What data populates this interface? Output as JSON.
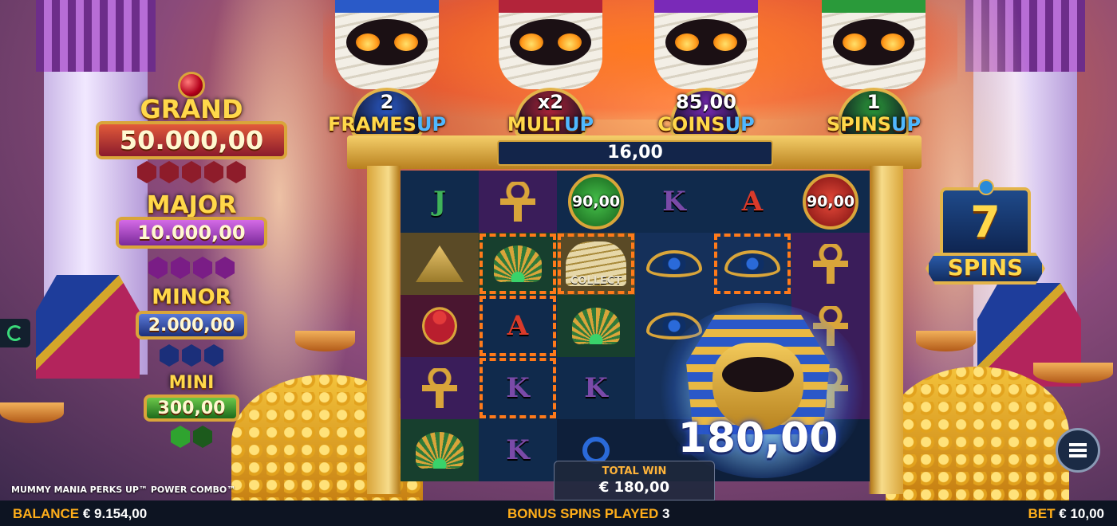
{
  "game": {
    "name": "MUMMY MANIA PERKS UP™ POWER COMBO™"
  },
  "jackpots": {
    "grand": {
      "label": "GRAND",
      "value": "50.000,00"
    },
    "major": {
      "label": "MAJOR",
      "value": "10.000,00"
    },
    "minor": {
      "label": "MINOR",
      "value": "2.000,00"
    },
    "mini": {
      "label": "MINI",
      "value": "300,00"
    }
  },
  "perks": [
    {
      "value": "2",
      "label": "FRAMES",
      "up": "UP",
      "color": "#2a5ac8"
    },
    {
      "value": "x2",
      "label": "MULT",
      "up": "UP",
      "color": "#b3243a"
    },
    {
      "value": "85,00",
      "label": "COINS",
      "up": "UP",
      "color": "#7a2ab8"
    },
    {
      "value": "1",
      "label": "SPINS",
      "up": "UP",
      "color": "#2a9a3a"
    }
  ],
  "collected_value": "16,00",
  "grid": {
    "rows": [
      [
        {
          "symbol": "letter",
          "text": "J",
          "variant": "j",
          "bg": "navy"
        },
        {
          "symbol": "ankh",
          "text": "",
          "bg": "purple"
        },
        {
          "symbol": "coin",
          "text": "90,00",
          "variant": "green",
          "bg": "navy"
        },
        {
          "symbol": "letter",
          "text": "K",
          "variant": "k",
          "bg": "navy"
        },
        {
          "symbol": "letter",
          "text": "A",
          "variant": "a",
          "bg": "navy"
        },
        {
          "symbol": "coin",
          "text": "90,00",
          "variant": "red",
          "bg": "navy"
        }
      ],
      [
        {
          "symbol": "pyramid",
          "text": "",
          "bg": "gold"
        },
        {
          "symbol": "fan",
          "text": "",
          "bg": "green",
          "highlight": true
        },
        {
          "symbol": "collect",
          "text": "COLLECT",
          "bg": "gold",
          "highlight": true
        },
        {
          "symbol": "eye",
          "text": "",
          "bg": "blue"
        },
        {
          "symbol": "eye",
          "text": "",
          "bg": "blue",
          "highlight": true
        },
        {
          "symbol": "ankh",
          "text": "",
          "bg": "purple"
        }
      ],
      [
        {
          "symbol": "scarab",
          "text": "",
          "bg": "red"
        },
        {
          "symbol": "letter",
          "text": "A",
          "variant": "a",
          "bg": "navy",
          "highlight": true
        },
        {
          "symbol": "fan",
          "text": "",
          "bg": "green"
        },
        {
          "symbol": "eye",
          "text": "",
          "bg": "blue"
        },
        {
          "symbol": "empty",
          "text": "",
          "bg": "blue"
        },
        {
          "symbol": "ankh",
          "text": "",
          "bg": "purple"
        }
      ],
      [
        {
          "symbol": "ankh",
          "text": "",
          "bg": "purple"
        },
        {
          "symbol": "letter",
          "text": "K",
          "variant": "k",
          "bg": "navy",
          "highlight": true
        },
        {
          "symbol": "letter",
          "text": "K",
          "variant": "k",
          "bg": "navy"
        },
        {
          "symbol": "empty",
          "text": "",
          "bg": "blue"
        },
        {
          "symbol": "empty",
          "text": "",
          "bg": "blue"
        },
        {
          "symbol": "ankh",
          "text": "",
          "bg": "purple"
        }
      ],
      [
        {
          "symbol": "fan",
          "text": "",
          "bg": "green"
        },
        {
          "symbol": "letter",
          "text": "K",
          "variant": "k",
          "bg": "navy"
        },
        {
          "symbol": "ring",
          "text": "",
          "bg": "dark"
        },
        {
          "symbol": "empty",
          "text": "",
          "bg": "dark"
        },
        {
          "symbol": "empty",
          "text": "",
          "bg": "dark"
        },
        {
          "symbol": "empty",
          "text": "",
          "bg": "dark"
        }
      ]
    ]
  },
  "big_win": "180,00",
  "total_win": {
    "label": "TOTAL WIN",
    "value": "€ 180,00"
  },
  "spins_remaining": {
    "count": "7",
    "label": "SPINS"
  },
  "bottom_bar": {
    "balance_label": "BALANCE",
    "balance_value": "€ 9.154,00",
    "spins_label": "BONUS SPINS PLAYED",
    "spins_value": "3",
    "bet_label": "BET",
    "bet_value": "€ 10,00"
  },
  "icons": {
    "replay": "replay-icon",
    "menu": "hamburger-menu-icon"
  },
  "colors": {
    "accent": "#ffae1a",
    "highlight": "#ff7a1a"
  }
}
